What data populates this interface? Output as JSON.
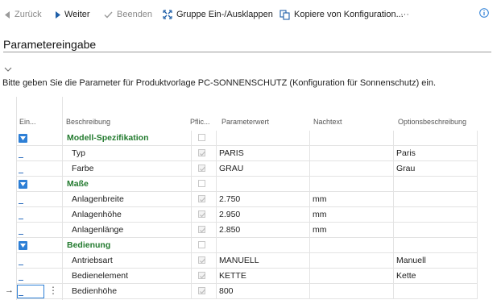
{
  "toolbar": {
    "back": "Zurück",
    "next": "Weiter",
    "finish": "Beenden",
    "toggle_group": "Gruppe Ein-/Ausklappen",
    "copy_config": "Kopiere von Konfiguration...",
    "more": "···"
  },
  "page": {
    "title": "Parametereingabe",
    "instruction": "Bitte geben Sie die Parameter für Produktvorlage PC-SONNENSCHUTZ (Konfiguration für Sonnenschutz) ein."
  },
  "grid": {
    "headers": [
      "Ein...",
      "Beschreibung",
      "Pflic...",
      "Parameterwert",
      "Nachtext",
      "Optionsbeschreibung"
    ],
    "rows": [
      {
        "type": "group",
        "description": "Modell-Spezifikation",
        "required": false,
        "value": "",
        "suffix": "",
        "option": ""
      },
      {
        "type": "param",
        "description": "Typ",
        "required": true,
        "value": "PARIS",
        "suffix": "",
        "option": "Paris"
      },
      {
        "type": "param",
        "description": "Farbe",
        "required": true,
        "value": "GRAU",
        "suffix": "",
        "option": "Grau"
      },
      {
        "type": "group",
        "description": "Maße",
        "required": false,
        "value": "",
        "suffix": "",
        "option": ""
      },
      {
        "type": "param",
        "description": "Anlagenbreite",
        "required": true,
        "value": "2.750",
        "suffix": "mm",
        "option": ""
      },
      {
        "type": "param",
        "description": "Anlagenhöhe",
        "required": true,
        "value": "2.950",
        "suffix": "mm",
        "option": ""
      },
      {
        "type": "param",
        "description": "Anlagenlänge",
        "required": true,
        "value": "2.850",
        "suffix": "mm",
        "option": ""
      },
      {
        "type": "group",
        "description": "Bedienung",
        "required": false,
        "value": "",
        "suffix": "",
        "option": ""
      },
      {
        "type": "param",
        "description": "Antriebsart",
        "required": true,
        "value": "MANUELL",
        "suffix": "",
        "option": "Manuell"
      },
      {
        "type": "param",
        "description": "Bedienelement",
        "required": true,
        "value": "KETTE",
        "suffix": "",
        "option": "Kette"
      },
      {
        "type": "param",
        "description": "Bedienhöhe",
        "required": true,
        "value": "800",
        "suffix": "",
        "option": "",
        "selected": true
      }
    ]
  },
  "colors": {
    "accent": "#2d7fd6",
    "group_text": "#227a2e",
    "toolbar_icon": "#1f5fa8"
  }
}
